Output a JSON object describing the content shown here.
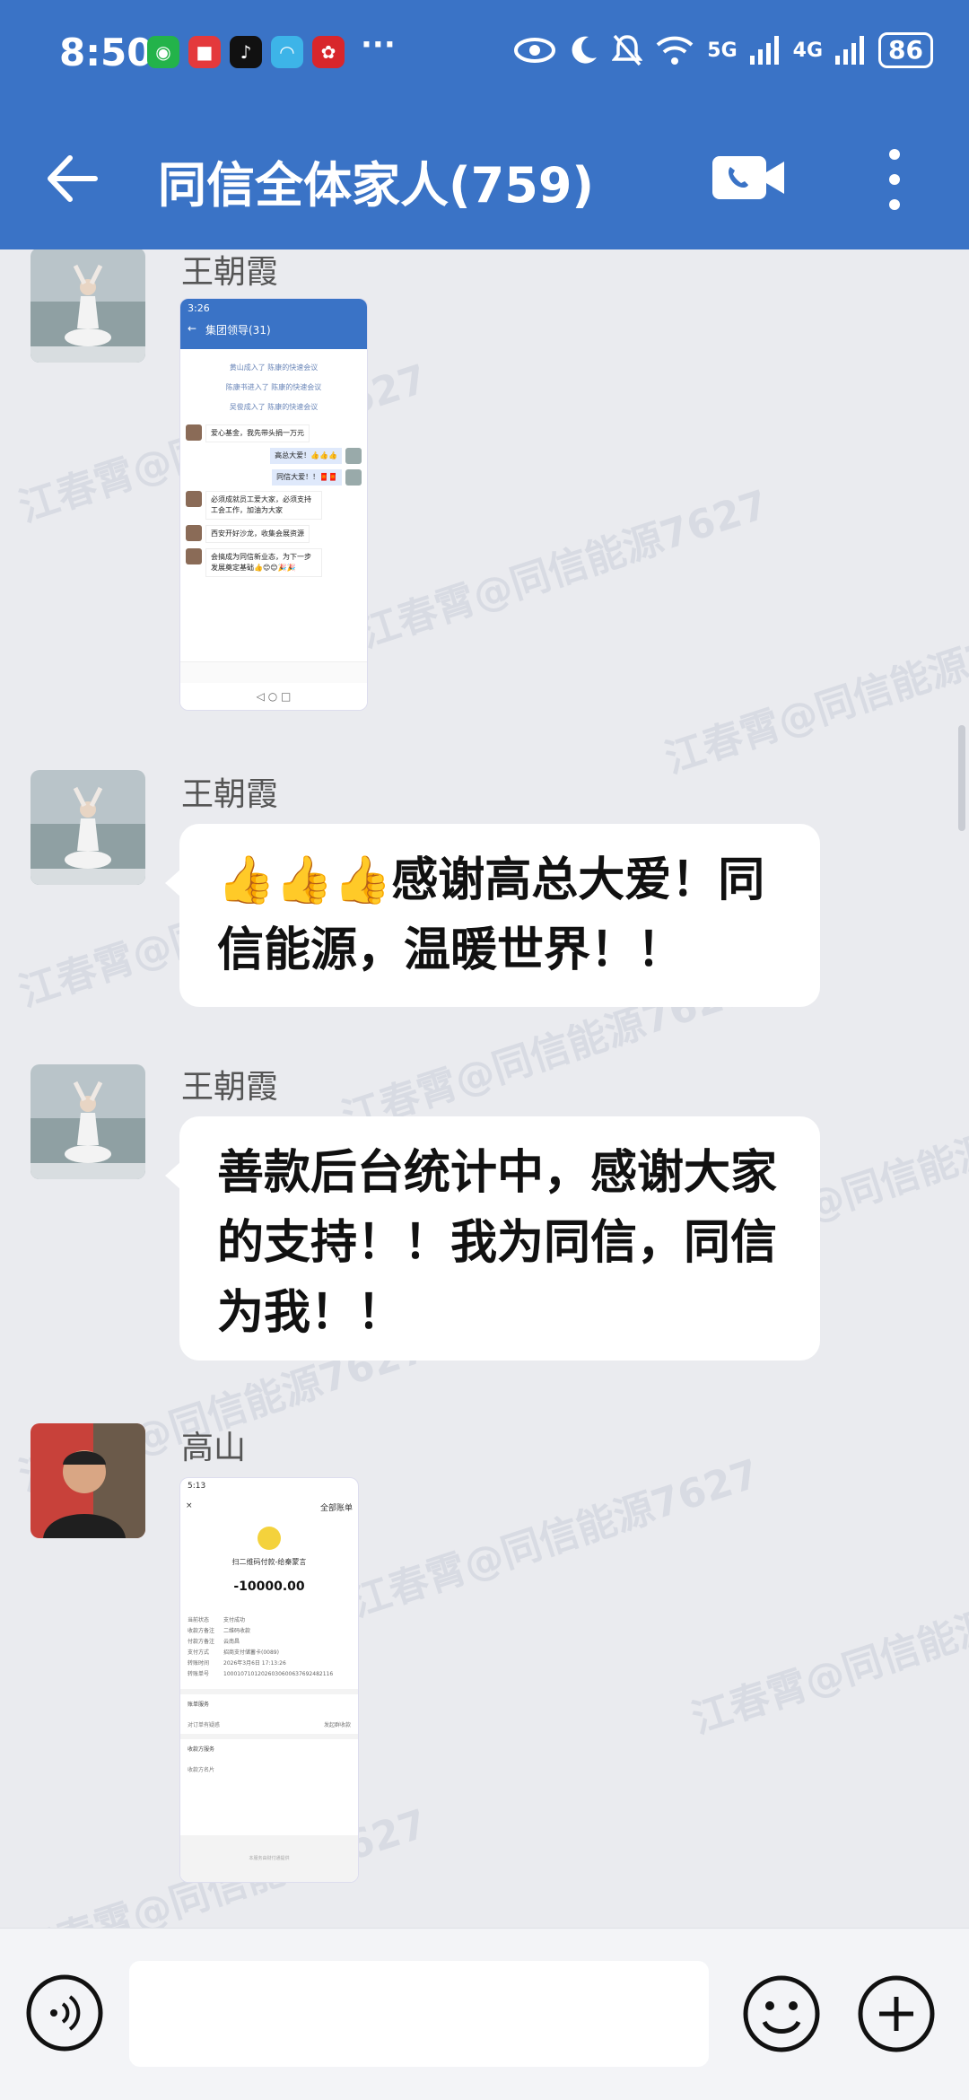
{
  "status_bar": {
    "time": "8:50",
    "more_dots": "···",
    "network_5g": "5G",
    "network_4g": "4G",
    "battery": "86",
    "app_icons": [
      "wechat-icon",
      "red-app-icon",
      "tiktok-icon",
      "app-icon",
      "lottery-icon"
    ]
  },
  "header": {
    "title": "同信全体家人(759)",
    "colors": {
      "bar": "#3a73c6"
    }
  },
  "messages": [
    {
      "sender": "王朝霞",
      "type": "image",
      "screenshot": {
        "time": "3:26",
        "title": "集团领导(31)",
        "sys1": "黄山成入了 陈康的快速会议",
        "sys2": "陈康书进入了 陈康的快速会议",
        "sys3": "吴俊成入了 陈康的快速会议",
        "msgs": [
          {
            "side": "left",
            "text": "爱心基金，我先带头捐一万元"
          },
          {
            "side": "right",
            "text": "高总大爱！👍👍👍"
          },
          {
            "side": "right",
            "text": "同信大爱！！🧧🧧"
          },
          {
            "side": "left",
            "text": "必须成就员工爱大家，必须支持工会工作，加油为大家"
          },
          {
            "side": "left",
            "text": "西安开好沙龙，收集会展资源"
          },
          {
            "side": "left",
            "text": "会搞成为同信新业态，为下一步发展奠定基础👍😊😊🎉🎉"
          }
        ]
      }
    },
    {
      "sender": "王朝霞",
      "type": "text",
      "text": "👍👍👍感谢高总大爱！同信能源，温暖世界！！"
    },
    {
      "sender": "王朝霞",
      "type": "text",
      "text": "善款后台统计中，感谢大家的支持！！我为同信，同信为我！！"
    },
    {
      "sender": "高山",
      "type": "image",
      "receipt": {
        "time": "5:13",
        "all_bills": "全部账单",
        "merchant": "扫二维码付款-给秦蒙言",
        "amount": "-10000.00",
        "rows": [
          [
            "当前状态",
            "支付成功"
          ],
          [
            "收款方备注",
            "二维码收款"
          ],
          [
            "付款方备注",
            "云南昌"
          ],
          [
            "支付方式",
            "招商支付储蓄卡(0089)"
          ],
          [
            "转账时间",
            "2026年3月6日 17:13:26"
          ],
          [
            "转账单号",
            "10001071012026030600637692482116"
          ]
        ],
        "section1": "账单服务",
        "svc1": "对订单有疑惑",
        "svc2": "发起群收款",
        "section2": "收款方服务",
        "svc3": "收款方名片",
        "footer": "本服务由财付通提供"
      }
    }
  ],
  "watermark": "江春霄@同信能源7627",
  "input": {
    "placeholder": ""
  }
}
